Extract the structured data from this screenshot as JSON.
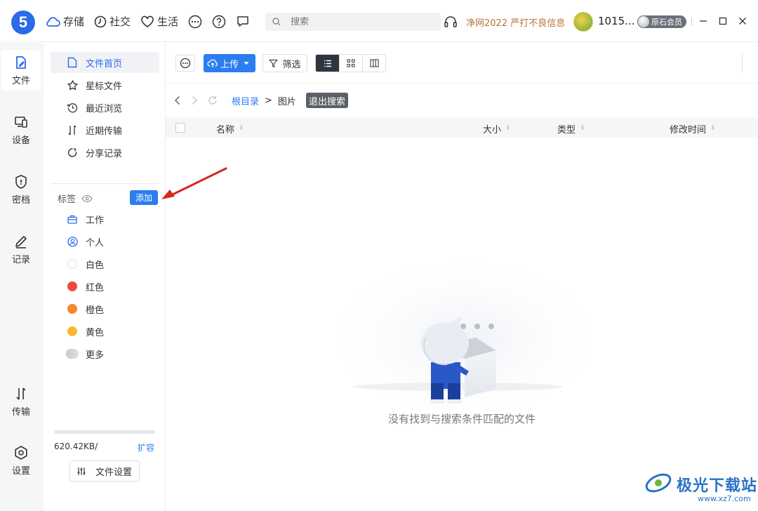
{
  "app": {
    "logo_text": "5",
    "brand_color": "#2b6be8",
    "accent_color": "#2b7df0"
  },
  "topnav": {
    "items": [
      {
        "label": "存储",
        "icon": "cloud-icon"
      },
      {
        "label": "社交",
        "icon": "clock-icon"
      },
      {
        "label": "生活",
        "icon": "heart-icon"
      }
    ],
    "search_placeholder": "搜索",
    "promo": "净网2022 严打不良信息",
    "username": "1015...",
    "member_badge": "原石会员"
  },
  "rail": {
    "items": [
      {
        "label": "文件",
        "icon": "file-edit-icon",
        "active": true
      },
      {
        "label": "设备",
        "icon": "devices-icon"
      },
      {
        "label": "密档",
        "icon": "shield-icon"
      },
      {
        "label": "记录",
        "icon": "pencil-icon"
      },
      {
        "label": "传输",
        "icon": "transfer-icon"
      },
      {
        "label": "设置",
        "icon": "settings-icon"
      }
    ]
  },
  "sidebar": {
    "items": [
      {
        "label": "文件首页",
        "icon": "document-icon",
        "active": true
      },
      {
        "label": "星标文件",
        "icon": "star-icon"
      },
      {
        "label": "最近浏览",
        "icon": "history-icon"
      },
      {
        "label": "近期传输",
        "icon": "transfer-icon"
      },
      {
        "label": "分享记录",
        "icon": "share-icon"
      }
    ],
    "tags_title": "标签",
    "add_label": "添加",
    "tags": [
      {
        "label": "工作",
        "icon": "briefcase-icon"
      },
      {
        "label": "个人",
        "icon": "user-icon"
      },
      {
        "label": "白色",
        "color": "#ffffff"
      },
      {
        "label": "红色",
        "color": "#f04a3e"
      },
      {
        "label": "橙色",
        "color": "#f7862a"
      },
      {
        "label": "黄色",
        "color": "#fbb734"
      },
      {
        "label": "更多",
        "color": "#cfcfcf"
      }
    ],
    "storage_used": "620.42KB/",
    "expand_label": "扩容",
    "file_settings_label": "文件设置"
  },
  "toolbar": {
    "upload_label": "上传",
    "filter_label": "筛选"
  },
  "breadcrumb": {
    "root": "根目录",
    "separator": ">",
    "current": "图片",
    "exit_search": "退出搜索"
  },
  "table": {
    "headers": {
      "name": "名称",
      "size": "大小",
      "type": "类型",
      "modified": "修改时间"
    }
  },
  "empty_state": {
    "message": "没有找到与搜索条件匹配的文件"
  },
  "watermark": {
    "title": "极光下载站",
    "url": "www.xz7.com"
  }
}
